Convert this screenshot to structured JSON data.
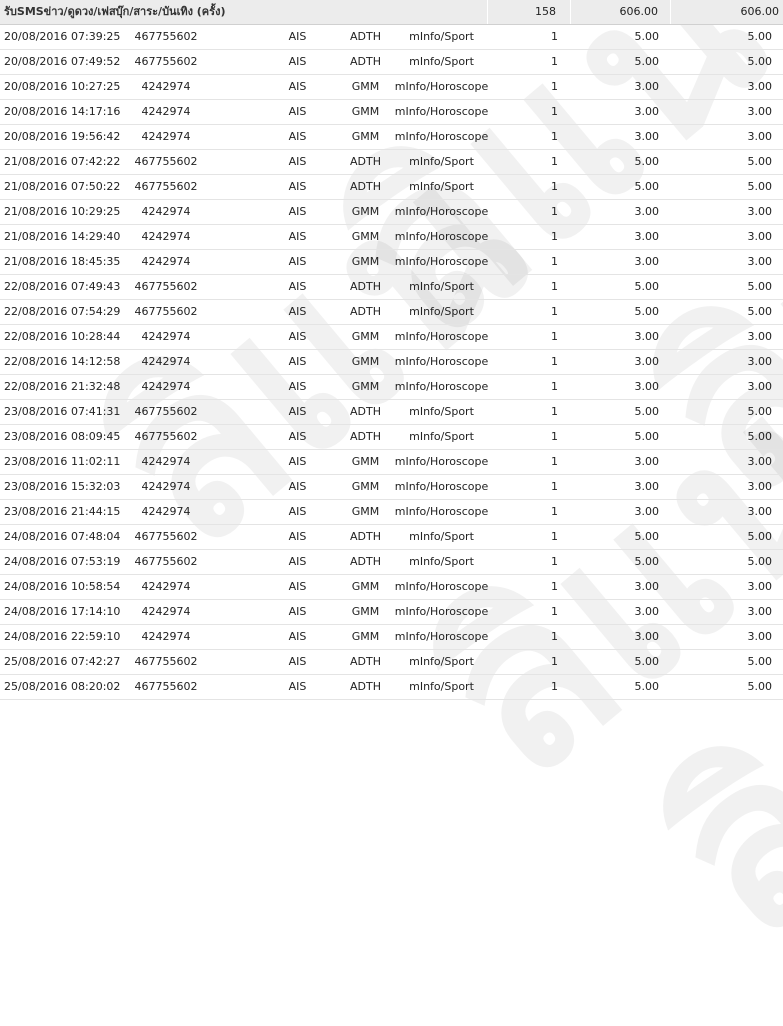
{
  "summary": {
    "title": "รับSMSข่าว/ดูดวง/เฟสบุ๊ก/สาระ/บันเทิง (ครั้ง)",
    "count": "158",
    "amount": "606.00",
    "total": "606.00"
  },
  "watermark_text": "ลิแน",
  "rows": [
    {
      "date": "20/08/2016",
      "time": "07:39:25",
      "number": "467755602",
      "operator": "AIS",
      "provider": "ADTH",
      "service": "mInfo/Sport",
      "count": "1",
      "price": "5.00",
      "total": "5.00"
    },
    {
      "date": "20/08/2016",
      "time": "07:49:52",
      "number": "467755602",
      "operator": "AIS",
      "provider": "ADTH",
      "service": "mInfo/Sport",
      "count": "1",
      "price": "5.00",
      "total": "5.00"
    },
    {
      "date": "20/08/2016",
      "time": "10:27:25",
      "number": "4242974",
      "operator": "AIS",
      "provider": "GMM",
      "service": "mInfo/Horoscope",
      "count": "1",
      "price": "3.00",
      "total": "3.00"
    },
    {
      "date": "20/08/2016",
      "time": "14:17:16",
      "number": "4242974",
      "operator": "AIS",
      "provider": "GMM",
      "service": "mInfo/Horoscope",
      "count": "1",
      "price": "3.00",
      "total": "3.00"
    },
    {
      "date": "20/08/2016",
      "time": "19:56:42",
      "number": "4242974",
      "operator": "AIS",
      "provider": "GMM",
      "service": "mInfo/Horoscope",
      "count": "1",
      "price": "3.00",
      "total": "3.00"
    },
    {
      "date": "21/08/2016",
      "time": "07:42:22",
      "number": "467755602",
      "operator": "AIS",
      "provider": "ADTH",
      "service": "mInfo/Sport",
      "count": "1",
      "price": "5.00",
      "total": "5.00"
    },
    {
      "date": "21/08/2016",
      "time": "07:50:22",
      "number": "467755602",
      "operator": "AIS",
      "provider": "ADTH",
      "service": "mInfo/Sport",
      "count": "1",
      "price": "5.00",
      "total": "5.00"
    },
    {
      "date": "21/08/2016",
      "time": "10:29:25",
      "number": "4242974",
      "operator": "AIS",
      "provider": "GMM",
      "service": "mInfo/Horoscope",
      "count": "1",
      "price": "3.00",
      "total": "3.00"
    },
    {
      "date": "21/08/2016",
      "time": "14:29:40",
      "number": "4242974",
      "operator": "AIS",
      "provider": "GMM",
      "service": "mInfo/Horoscope",
      "count": "1",
      "price": "3.00",
      "total": "3.00"
    },
    {
      "date": "21/08/2016",
      "time": "18:45:35",
      "number": "4242974",
      "operator": "AIS",
      "provider": "GMM",
      "service": "mInfo/Horoscope",
      "count": "1",
      "price": "3.00",
      "total": "3.00"
    },
    {
      "date": "22/08/2016",
      "time": "07:49:43",
      "number": "467755602",
      "operator": "AIS",
      "provider": "ADTH",
      "service": "mInfo/Sport",
      "count": "1",
      "price": "5.00",
      "total": "5.00"
    },
    {
      "date": "22/08/2016",
      "time": "07:54:29",
      "number": "467755602",
      "operator": "AIS",
      "provider": "ADTH",
      "service": "mInfo/Sport",
      "count": "1",
      "price": "5.00",
      "total": "5.00"
    },
    {
      "date": "22/08/2016",
      "time": "10:28:44",
      "number": "4242974",
      "operator": "AIS",
      "provider": "GMM",
      "service": "mInfo/Horoscope",
      "count": "1",
      "price": "3.00",
      "total": "3.00"
    },
    {
      "date": "22/08/2016",
      "time": "14:12:58",
      "number": "4242974",
      "operator": "AIS",
      "provider": "GMM",
      "service": "mInfo/Horoscope",
      "count": "1",
      "price": "3.00",
      "total": "3.00"
    },
    {
      "date": "22/08/2016",
      "time": "21:32:48",
      "number": "4242974",
      "operator": "AIS",
      "provider": "GMM",
      "service": "mInfo/Horoscope",
      "count": "1",
      "price": "3.00",
      "total": "3.00"
    },
    {
      "date": "23/08/2016",
      "time": "07:41:31",
      "number": "467755602",
      "operator": "AIS",
      "provider": "ADTH",
      "service": "mInfo/Sport",
      "count": "1",
      "price": "5.00",
      "total": "5.00"
    },
    {
      "date": "23/08/2016",
      "time": "08:09:45",
      "number": "467755602",
      "operator": "AIS",
      "provider": "ADTH",
      "service": "mInfo/Sport",
      "count": "1",
      "price": "5.00",
      "total": "5.00"
    },
    {
      "date": "23/08/2016",
      "time": "11:02:11",
      "number": "4242974",
      "operator": "AIS",
      "provider": "GMM",
      "service": "mInfo/Horoscope",
      "count": "1",
      "price": "3.00",
      "total": "3.00"
    },
    {
      "date": "23/08/2016",
      "time": "15:32:03",
      "number": "4242974",
      "operator": "AIS",
      "provider": "GMM",
      "service": "mInfo/Horoscope",
      "count": "1",
      "price": "3.00",
      "total": "3.00"
    },
    {
      "date": "23/08/2016",
      "time": "21:44:15",
      "number": "4242974",
      "operator": "AIS",
      "provider": "GMM",
      "service": "mInfo/Horoscope",
      "count": "1",
      "price": "3.00",
      "total": "3.00"
    },
    {
      "date": "24/08/2016",
      "time": "07:48:04",
      "number": "467755602",
      "operator": "AIS",
      "provider": "ADTH",
      "service": "mInfo/Sport",
      "count": "1",
      "price": "5.00",
      "total": "5.00"
    },
    {
      "date": "24/08/2016",
      "time": "07:53:19",
      "number": "467755602",
      "operator": "AIS",
      "provider": "ADTH",
      "service": "mInfo/Sport",
      "count": "1",
      "price": "5.00",
      "total": "5.00"
    },
    {
      "date": "24/08/2016",
      "time": "10:58:54",
      "number": "4242974",
      "operator": "AIS",
      "provider": "GMM",
      "service": "mInfo/Horoscope",
      "count": "1",
      "price": "3.00",
      "total": "3.00"
    },
    {
      "date": "24/08/2016",
      "time": "17:14:10",
      "number": "4242974",
      "operator": "AIS",
      "provider": "GMM",
      "service": "mInfo/Horoscope",
      "count": "1",
      "price": "3.00",
      "total": "3.00"
    },
    {
      "date": "24/08/2016",
      "time": "22:59:10",
      "number": "4242974",
      "operator": "AIS",
      "provider": "GMM",
      "service": "mInfo/Horoscope",
      "count": "1",
      "price": "3.00",
      "total": "3.00"
    },
    {
      "date": "25/08/2016",
      "time": "07:42:27",
      "number": "467755602",
      "operator": "AIS",
      "provider": "ADTH",
      "service": "mInfo/Sport",
      "count": "1",
      "price": "5.00",
      "total": "5.00"
    },
    {
      "date": "25/08/2016",
      "time": "08:20:02",
      "number": "467755602",
      "operator": "AIS",
      "provider": "ADTH",
      "service": "mInfo/Sport",
      "count": "1",
      "price": "5.00",
      "total": "5.00"
    }
  ]
}
